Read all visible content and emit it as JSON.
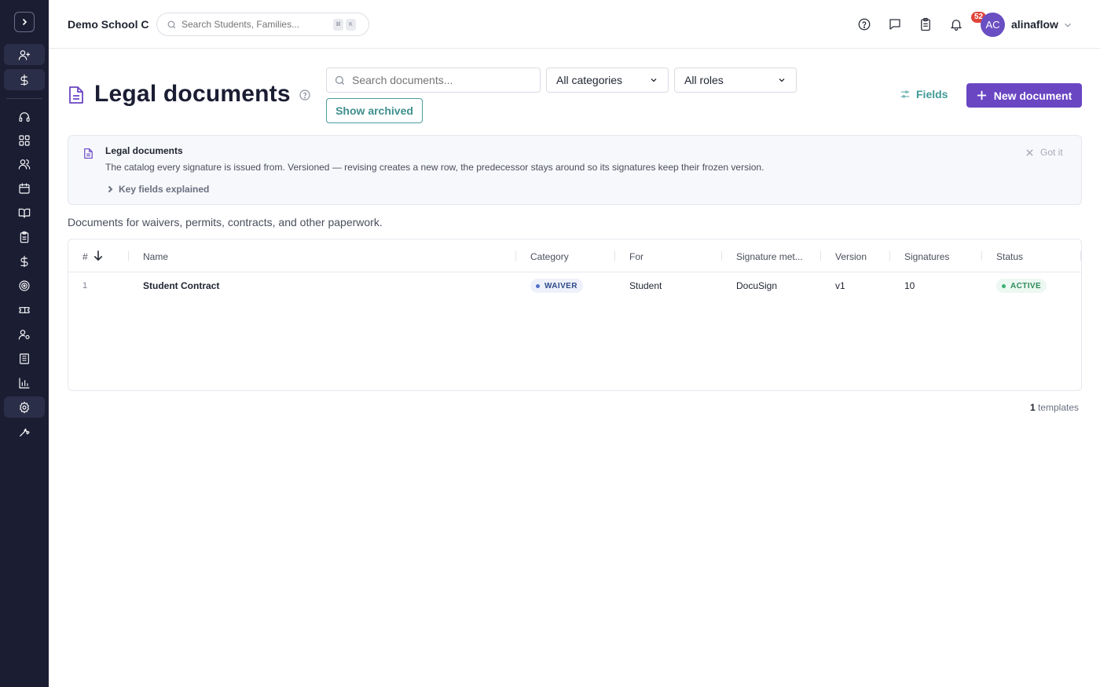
{
  "topbar": {
    "school_name": "Demo School C",
    "search_placeholder": "Search Students, Families...",
    "shortcut_keys": [
      "⌘",
      "K"
    ],
    "notification_badge": "52",
    "user_initials": "AC",
    "username": "alinaflow"
  },
  "sidebar": {
    "items": [
      {
        "icon": "user-plus-icon",
        "active": true
      },
      {
        "icon": "dollar-icon",
        "active": true
      },
      {
        "icon": "headset-icon",
        "active": false
      },
      {
        "icon": "grid-icon",
        "active": false
      },
      {
        "icon": "users-icon",
        "active": false
      },
      {
        "icon": "calendar-icon",
        "active": false
      },
      {
        "icon": "book-icon",
        "active": false
      },
      {
        "icon": "clipboard-icon",
        "active": false
      },
      {
        "icon": "dollar-icon",
        "active": false
      },
      {
        "icon": "target-icon",
        "active": false
      },
      {
        "icon": "ticket-icon",
        "active": false
      },
      {
        "icon": "user-gear-icon",
        "active": false
      },
      {
        "icon": "building-icon",
        "active": false
      },
      {
        "icon": "bar-chart-icon",
        "active": false
      },
      {
        "icon": "gear-icon",
        "active": true
      },
      {
        "icon": "wrench-icon",
        "active": false
      }
    ]
  },
  "header": {
    "title": "Legal documents",
    "search_placeholder": "Search documents...",
    "category_filter": "All categories",
    "role_filter": "All roles",
    "show_archived_label": "Show archived",
    "fields_label": "Fields",
    "new_document_label": "New document"
  },
  "info": {
    "title": "Legal documents",
    "text": "The catalog every signature is issued from. Versioned — revising creates a new row, the predecessor stays around so its signatures keep their frozen version.",
    "expand_label": "Key fields explained",
    "dismiss_label": "Got it"
  },
  "subtitle": "Documents for waivers, permits, contracts, and other paperwork.",
  "table": {
    "columns": [
      "#",
      "Name",
      "Category",
      "For",
      "Signature met...",
      "Version",
      "Signatures",
      "Status"
    ],
    "rows": [
      {
        "num": "1",
        "name": "Student Contract",
        "category": "WAIVER",
        "for": "Student",
        "signature_method": "DocuSign",
        "version": "v1",
        "signatures": "10",
        "status": "ACTIVE"
      }
    ]
  },
  "footer": {
    "count": "1",
    "count_label": "templates"
  },
  "colors": {
    "sidebar_bg": "#1b1d33",
    "primary": "#6a46c3",
    "teal": "#3f9a98",
    "active_green": "#2f8a5a",
    "waiver_blue": "#2e4a8a",
    "badge_red": "#e0443a"
  }
}
